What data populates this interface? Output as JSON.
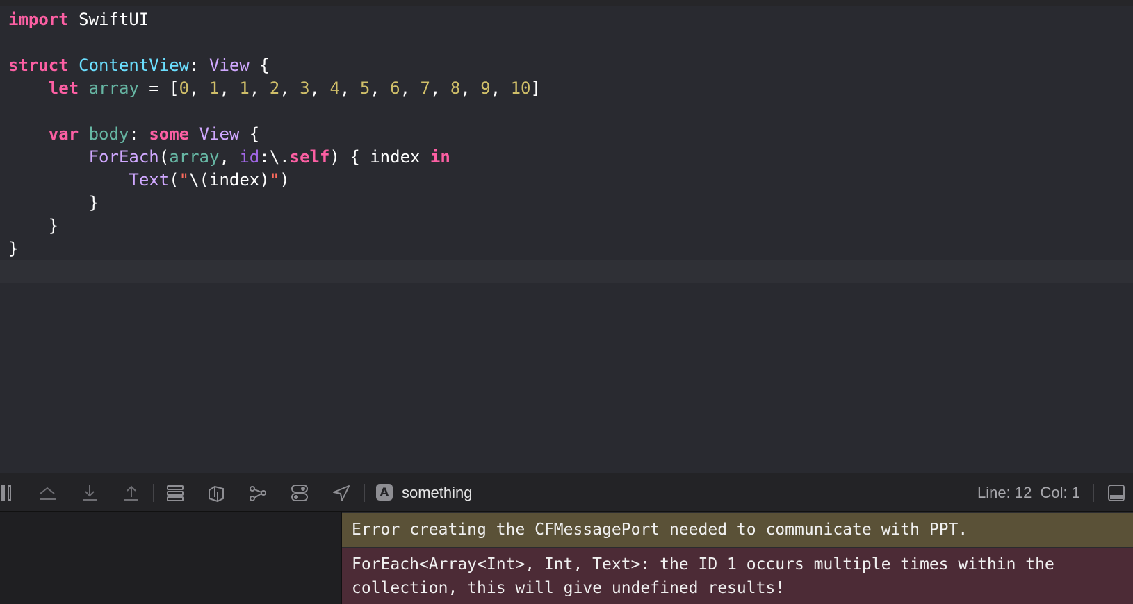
{
  "editor": {
    "lines": [
      [
        [
          "kw",
          "import"
        ],
        [
          "plain",
          " SwiftUI"
        ]
      ],
      [],
      [
        [
          "kw",
          "struct"
        ],
        [
          "plain",
          " "
        ],
        [
          "decl",
          "ContentView"
        ],
        [
          "plain",
          ": "
        ],
        [
          "type",
          "View"
        ],
        [
          "plain",
          " {"
        ]
      ],
      [
        [
          "plain",
          "    "
        ],
        [
          "kw",
          "let"
        ],
        [
          "plain",
          " "
        ],
        [
          "prop",
          "array"
        ],
        [
          "plain",
          " = ["
        ],
        [
          "num",
          "0"
        ],
        [
          "plain",
          ", "
        ],
        [
          "num",
          "1"
        ],
        [
          "plain",
          ", "
        ],
        [
          "num",
          "1"
        ],
        [
          "plain",
          ", "
        ],
        [
          "num",
          "2"
        ],
        [
          "plain",
          ", "
        ],
        [
          "num",
          "3"
        ],
        [
          "plain",
          ", "
        ],
        [
          "num",
          "4"
        ],
        [
          "plain",
          ", "
        ],
        [
          "num",
          "5"
        ],
        [
          "plain",
          ", "
        ],
        [
          "num",
          "6"
        ],
        [
          "plain",
          ", "
        ],
        [
          "num",
          "7"
        ],
        [
          "plain",
          ", "
        ],
        [
          "num",
          "8"
        ],
        [
          "plain",
          ", "
        ],
        [
          "num",
          "9"
        ],
        [
          "plain",
          ", "
        ],
        [
          "num",
          "10"
        ],
        [
          "plain",
          "]"
        ]
      ],
      [],
      [
        [
          "plain",
          "    "
        ],
        [
          "kw",
          "var"
        ],
        [
          "plain",
          " "
        ],
        [
          "prop",
          "body"
        ],
        [
          "plain",
          ": "
        ],
        [
          "kw",
          "some"
        ],
        [
          "plain",
          " "
        ],
        [
          "type",
          "View"
        ],
        [
          "plain",
          " {"
        ]
      ],
      [
        [
          "plain",
          "        "
        ],
        [
          "type",
          "ForEach"
        ],
        [
          "plain",
          "("
        ],
        [
          "prop",
          "array"
        ],
        [
          "plain",
          ", "
        ],
        [
          "method",
          "id"
        ],
        [
          "plain",
          ":\\."
        ],
        [
          "kw",
          "self"
        ],
        [
          "plain",
          ") { index "
        ],
        [
          "kw",
          "in"
        ]
      ],
      [
        [
          "plain",
          "            "
        ],
        [
          "type",
          "Text"
        ],
        [
          "plain",
          "("
        ],
        [
          "str",
          "\""
        ],
        [
          "plain",
          "\\(index)"
        ],
        [
          "str",
          "\""
        ],
        [
          "plain",
          ")"
        ]
      ],
      [
        [
          "plain",
          "        }"
        ]
      ],
      [
        [
          "plain",
          "    }"
        ]
      ],
      [
        [
          "plain",
          "}"
        ]
      ],
      []
    ],
    "current_line_index": 11
  },
  "toolbar": {
    "scheme_icon_glyph": "A",
    "scheme_name": "something",
    "position": "Line: 12  Col: 1",
    "icons": [
      "pause-icon",
      "step-over-icon",
      "step-into-icon",
      "step-out-icon",
      "view-hierarchy-icon",
      "memory-graph-icon",
      "environment-icon",
      "toggle-icon",
      "location-icon"
    ]
  },
  "console": {
    "warning_message": "Error creating the CFMessagePort needed to communicate with PPT.",
    "error_message": "ForEach<Array<Int>, Int, Text>: the ID 1 occurs multiple times within the collection, this will give undefined results!"
  },
  "colors": {
    "background": "#292a30",
    "keyword": "#fc5fa3",
    "type": "#d0a8ff",
    "declaration": "#6bdfff",
    "property": "#67b7a4",
    "number": "#d0bf69",
    "string": "#fc6a5d",
    "warning_bg": "#5a5137",
    "error_bg": "#4c2b36"
  }
}
